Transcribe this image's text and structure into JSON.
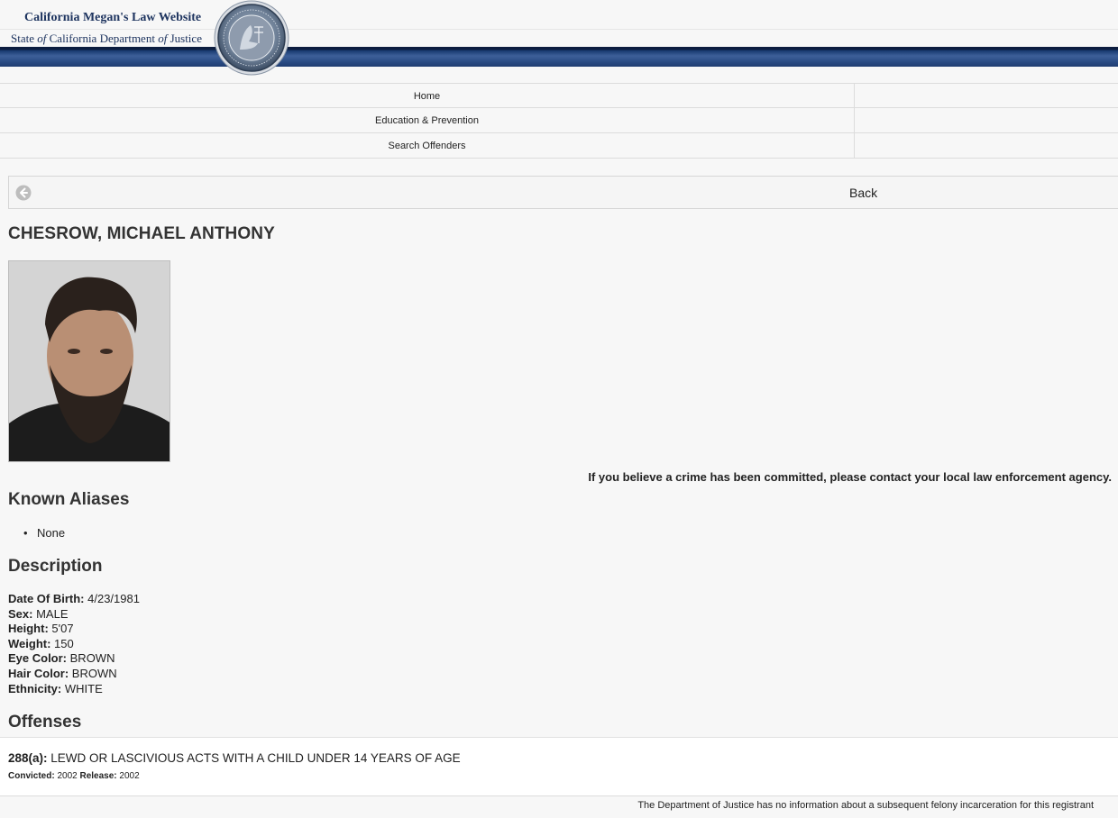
{
  "header": {
    "title": "California Megan's Law Website",
    "subtitle_parts": [
      "State ",
      "of",
      " California Department ",
      "of",
      " Justice"
    ],
    "seal_name": "state-seal"
  },
  "nav": {
    "items": [
      "Home",
      "Education & Prevention",
      "Search Offenders"
    ]
  },
  "back": {
    "label": "Back",
    "icon": "arrow-left-circle-icon"
  },
  "offender": {
    "name": "CHESROW, MICHAEL ANTHONY"
  },
  "notice": "If you believe a crime has been committed, please contact your local law enforcement agency.",
  "aliases": {
    "title": "Known Aliases",
    "items": [
      "None"
    ]
  },
  "description": {
    "title": "Description",
    "fields": [
      {
        "label": "Date Of Birth:",
        "value": "4/23/1981"
      },
      {
        "label": "Sex:",
        "value": "MALE"
      },
      {
        "label": "Height:",
        "value": "5'07"
      },
      {
        "label": "Weight:",
        "value": "150"
      },
      {
        "label": "Eye Color:",
        "value": "BROWN"
      },
      {
        "label": "Hair Color:",
        "value": "BROWN"
      },
      {
        "label": "Ethnicity:",
        "value": "WHITE"
      }
    ]
  },
  "offenses": {
    "title": "Offenses",
    "items": [
      {
        "code": "288(a):",
        "text": "LEWD OR LASCIVIOUS ACTS WITH A CHILD UNDER 14 YEARS OF AGE",
        "convicted_label": "Convicted:",
        "convicted": "2002",
        "release_label": "Release:",
        "release": "2002"
      }
    ]
  },
  "footer_note": "The Department of Justice has no information about a subsequent felony incarceration for this registrant"
}
